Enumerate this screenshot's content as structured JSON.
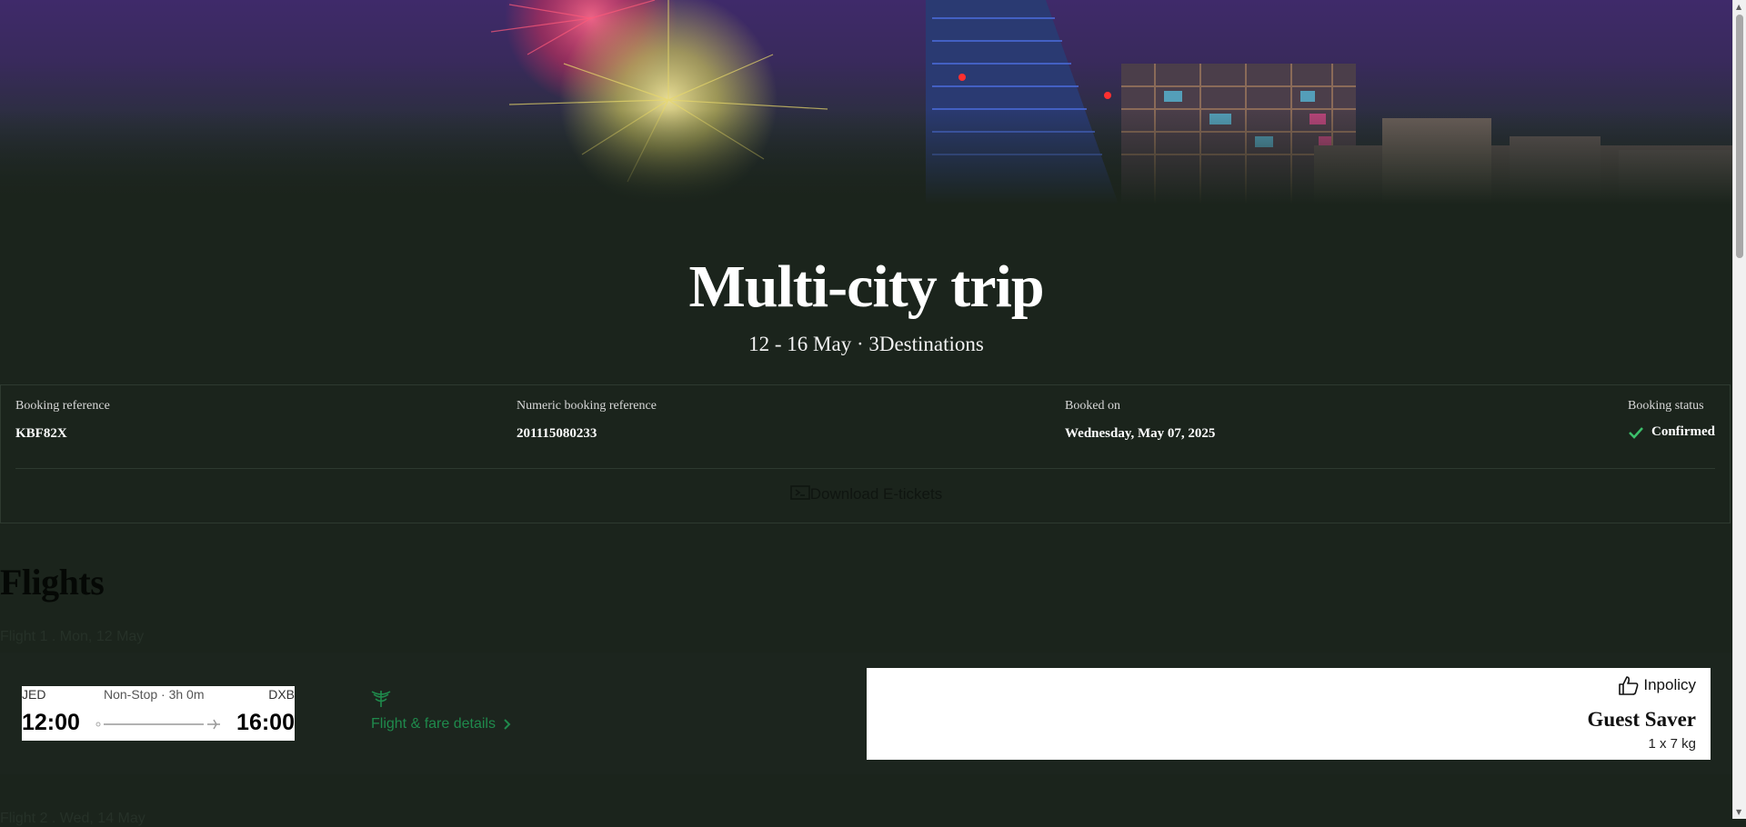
{
  "trip": {
    "title": "Multi-city trip",
    "subtitle": "12 - 16 May · 3Destinations"
  },
  "booking": {
    "reference_label": "Booking reference",
    "reference_value": "KBF82X",
    "numeric_label": "Numeric booking reference",
    "numeric_value": "201115080233",
    "booked_on_label": "Booked on",
    "booked_on_value": "Wednesday, May 07, 2025",
    "status_label": "Booking status",
    "status_value": "Confirmed",
    "download_label": "Download E-tickets"
  },
  "flights": {
    "heading": "Flights",
    "items": [
      {
        "label": "Flight 1 . Mon, 12 May",
        "from": "JED",
        "to": "DXB",
        "stops_duration": "Non-Stop · 3h 0m",
        "departure": "12:00",
        "arrival": "16:00",
        "details_link": "Flight & fare details",
        "policy": "Inpolicy",
        "fare_name": "Guest Saver",
        "baggage": "1 x 7 kg"
      },
      {
        "label": "Flight 2 . Wed, 14 May"
      }
    ]
  },
  "colors": {
    "background": "#1b241c",
    "accent_green": "#1f8a4c",
    "status_check": "#3cc06b"
  },
  "icons": [
    "fireworks-hero-image",
    "ticket-icon",
    "check-icon",
    "airline-emblem-icon",
    "chevron-right-icon",
    "thumbs-up-icon",
    "plane-icon"
  ]
}
